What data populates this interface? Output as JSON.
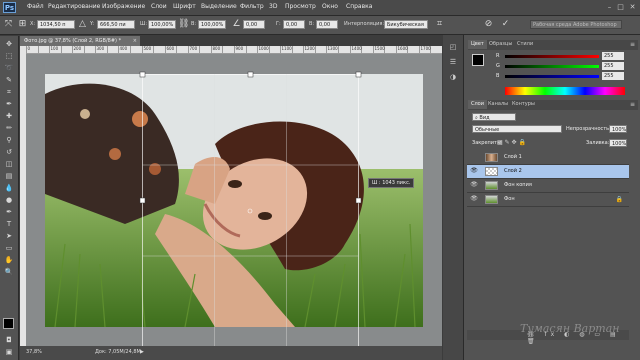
{
  "app": {
    "logo": "Ps"
  },
  "menu": [
    "Файл",
    "Редактирование",
    "Изображение",
    "Слои",
    "Шрифт",
    "Выделение",
    "Фильтр",
    "3D",
    "Просмотр",
    "Окно",
    "Справка"
  ],
  "options": {
    "x_label": "X:",
    "x_value": "1034,50 п",
    "y_label": "Y:",
    "y_value": "666,50 пи",
    "w_label": "Ш:",
    "w_value": "100,00%",
    "h_label": "В:",
    "h_value": "100,00%",
    "angle_value": "0,00",
    "hskew_label": "Г:",
    "hskew_value": "0,00",
    "vskew_label": "В:",
    "vskew_value": "0,00",
    "interp_label": "Интерполяция:",
    "interp_value": "Бикубическая",
    "workspace_value": "Рабочая среда Adobe Photoshop"
  },
  "document": {
    "tab_title": "Фото.jpg @ 37,8% (Слой 2, RGB/8#) *",
    "ruler_ticks": [
      "0",
      "50",
      "100",
      "150",
      "200",
      "250",
      "300",
      "350",
      "400",
      "450",
      "500",
      "550",
      "600",
      "650",
      "700",
      "750",
      "800",
      "850",
      "900",
      "950",
      "1000",
      "1050",
      "1100",
      "1150",
      "1200",
      "1250",
      "1300",
      "1350",
      "1400",
      "1450",
      "1500",
      "1550",
      "1600",
      "1650",
      "1700",
      "1750"
    ],
    "tooltip": "Ш : 1043 пикс."
  },
  "status": {
    "zoom": "37,8%",
    "doc": "Док: 7,05M/24,8M"
  },
  "color_panel": {
    "tabs": [
      "Цвет",
      "Образцы",
      "Стили"
    ],
    "r_label": "R",
    "g_label": "G",
    "b_label": "B",
    "r_value": "255",
    "g_value": "255",
    "b_value": "255",
    "fg_color": "#000000",
    "bg_color": "#ffffff"
  },
  "layers_panel": {
    "tabs": [
      "Слои",
      "Каналы",
      "Контуры"
    ],
    "filter_value": "Вид",
    "blend_value": "Обычные",
    "opacity_label": "Непрозрачность:",
    "opacity_value": "100%",
    "lock_label": "Закрепить:",
    "fill_label": "Заливка:",
    "fill_value": "100%",
    "layers": [
      {
        "name": "Слой 1",
        "visible": false,
        "selected": false
      },
      {
        "name": "Слой 2",
        "visible": true,
        "selected": true
      },
      {
        "name": "Фон копия",
        "visible": true,
        "selected": false
      },
      {
        "name": "Фон",
        "visible": true,
        "selected": false
      }
    ]
  },
  "watermark": "Тумасян Вартан"
}
